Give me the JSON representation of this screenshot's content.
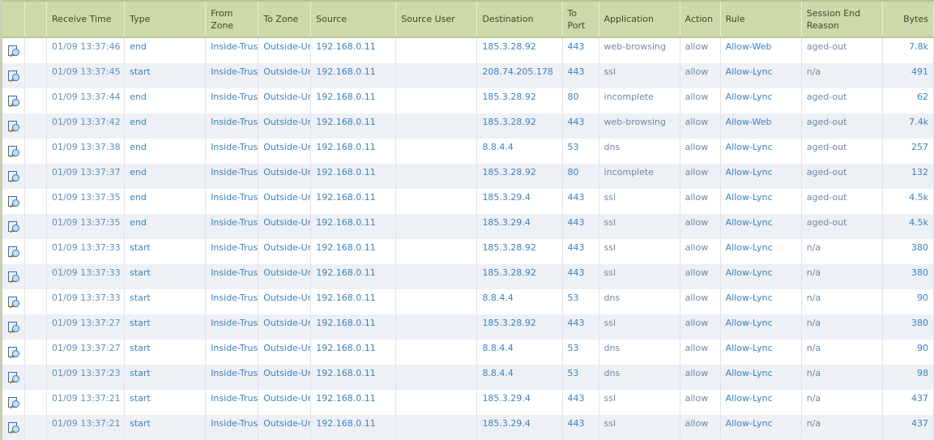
{
  "columns": [
    "",
    "",
    "Receive Time",
    "Type",
    "From Zone",
    "To Zone",
    "Source",
    "Source User",
    "Destination",
    "To Port",
    "Application",
    "Action",
    "Rule",
    "Session End Reason",
    "Bytes"
  ],
  "rows": [
    {
      "time": "01/09 13:37:46",
      "type": "end",
      "from": "Inside-Trust",
      "to": "Outside-Untrust",
      "source": "192.168.0.11",
      "user": "",
      "dest": "185.3.28.92",
      "port": "443",
      "app": "web-browsing",
      "action": "allow",
      "rule": "Allow-Web",
      "reason": "aged-out",
      "bytes": "7.8k"
    },
    {
      "time": "01/09 13:37:45",
      "type": "start",
      "from": "Inside-Trust",
      "to": "Outside-Untrust",
      "source": "192.168.0.11",
      "user": "",
      "dest": "208.74.205.178",
      "port": "443",
      "app": "ssl",
      "action": "allow",
      "rule": "Allow-Lync",
      "reason": "n/a",
      "bytes": "491"
    },
    {
      "time": "01/09 13:37:44",
      "type": "end",
      "from": "Inside-Trust",
      "to": "Outside-Untrust",
      "source": "192.168.0.11",
      "user": "",
      "dest": "185.3.28.92",
      "port": "80",
      "app": "incomplete",
      "action": "allow",
      "rule": "Allow-Lync",
      "reason": "aged-out",
      "bytes": "62"
    },
    {
      "time": "01/09 13:37:42",
      "type": "end",
      "from": "Inside-Trust",
      "to": "Outside-Untrust",
      "source": "192.168.0.11",
      "user": "",
      "dest": "185.3.28.92",
      "port": "443",
      "app": "web-browsing",
      "action": "allow",
      "rule": "Allow-Web",
      "reason": "aged-out",
      "bytes": "7.4k"
    },
    {
      "time": "01/09 13:37:38",
      "type": "end",
      "from": "Inside-Trust",
      "to": "Outside-Untrust",
      "source": "192.168.0.11",
      "user": "",
      "dest": "8.8.4.4",
      "port": "53",
      "app": "dns",
      "action": "allow",
      "rule": "Allow-Lync",
      "reason": "aged-out",
      "bytes": "257"
    },
    {
      "time": "01/09 13:37:37",
      "type": "end",
      "from": "Inside-Trust",
      "to": "Outside-Untrust",
      "source": "192.168.0.11",
      "user": "",
      "dest": "185.3.28.92",
      "port": "80",
      "app": "incomplete",
      "action": "allow",
      "rule": "Allow-Lync",
      "reason": "aged-out",
      "bytes": "132"
    },
    {
      "time": "01/09 13:37:35",
      "type": "end",
      "from": "Inside-Trust",
      "to": "Outside-Untrust",
      "source": "192.168.0.11",
      "user": "",
      "dest": "185.3.29.4",
      "port": "443",
      "app": "ssl",
      "action": "allow",
      "rule": "Allow-Lync",
      "reason": "aged-out",
      "bytes": "4.5k"
    },
    {
      "time": "01/09 13:37:35",
      "type": "end",
      "from": "Inside-Trust",
      "to": "Outside-Untrust",
      "source": "192.168.0.11",
      "user": "",
      "dest": "185.3.29.4",
      "port": "443",
      "app": "ssl",
      "action": "allow",
      "rule": "Allow-Lync",
      "reason": "aged-out",
      "bytes": "4.5k"
    },
    {
      "time": "01/09 13:37:33",
      "type": "start",
      "from": "Inside-Trust",
      "to": "Outside-Untrust",
      "source": "192.168.0.11",
      "user": "",
      "dest": "185.3.28.92",
      "port": "443",
      "app": "ssl",
      "action": "allow",
      "rule": "Allow-Lync",
      "reason": "n/a",
      "bytes": "380"
    },
    {
      "time": "01/09 13:37:33",
      "type": "start",
      "from": "Inside-Trust",
      "to": "Outside-Untrust",
      "source": "192.168.0.11",
      "user": "",
      "dest": "185.3.28.92",
      "port": "443",
      "app": "ssl",
      "action": "allow",
      "rule": "Allow-Lync",
      "reason": "n/a",
      "bytes": "380"
    },
    {
      "time": "01/09 13:37:33",
      "type": "start",
      "from": "Inside-Trust",
      "to": "Outside-Untrust",
      "source": "192.168.0.11",
      "user": "",
      "dest": "8.8.4.4",
      "port": "53",
      "app": "dns",
      "action": "allow",
      "rule": "Allow-Lync",
      "reason": "n/a",
      "bytes": "90"
    },
    {
      "time": "01/09 13:37:27",
      "type": "start",
      "from": "Inside-Trust",
      "to": "Outside-Untrust",
      "source": "192.168.0.11",
      "user": "",
      "dest": "185.3.28.92",
      "port": "443",
      "app": "ssl",
      "action": "allow",
      "rule": "Allow-Lync",
      "reason": "n/a",
      "bytes": "380"
    },
    {
      "time": "01/09 13:37:27",
      "type": "start",
      "from": "Inside-Trust",
      "to": "Outside-Untrust",
      "source": "192.168.0.11",
      "user": "",
      "dest": "8.8.4.4",
      "port": "53",
      "app": "dns",
      "action": "allow",
      "rule": "Allow-Lync",
      "reason": "n/a",
      "bytes": "90"
    },
    {
      "time": "01/09 13:37:23",
      "type": "start",
      "from": "Inside-Trust",
      "to": "Outside-Untrust",
      "source": "192.168.0.11",
      "user": "",
      "dest": "8.8.4.4",
      "port": "53",
      "app": "dns",
      "action": "allow",
      "rule": "Allow-Lync",
      "reason": "n/a",
      "bytes": "98"
    },
    {
      "time": "01/09 13:37:21",
      "type": "start",
      "from": "Inside-Trust",
      "to": "Outside-Untrust",
      "source": "192.168.0.11",
      "user": "",
      "dest": "185.3.29.4",
      "port": "443",
      "app": "ssl",
      "action": "allow",
      "rule": "Allow-Lync",
      "reason": "n/a",
      "bytes": "437"
    },
    {
      "time": "01/09 13:37:21",
      "type": "start",
      "from": "Inside-Trust",
      "to": "Outside-Untrust",
      "source": "192.168.0.11",
      "user": "",
      "dest": "185.3.29.4",
      "port": "443",
      "app": "ssl",
      "action": "allow",
      "rule": "Allow-Lync",
      "reason": "n/a",
      "bytes": "437"
    }
  ]
}
